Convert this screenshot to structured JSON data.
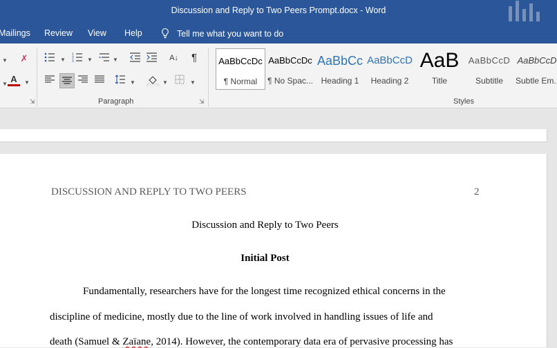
{
  "window": {
    "title": "Discussion and Reply to Two Peers Prompt.docx  -  Word"
  },
  "menu": {
    "tabs": [
      "Mailings",
      "Review",
      "View",
      "Help"
    ],
    "tell_me": "Tell me what you want to do"
  },
  "ribbon": {
    "paragraph_group_label": "Paragraph",
    "styles_group_label": "Styles",
    "styles": [
      {
        "preview": "AaBbCcDc",
        "label": "¶ Normal"
      },
      {
        "preview": "AaBbCcDc",
        "label": "¶ No Spac..."
      },
      {
        "preview": "AaBbCc",
        "label": "Heading 1"
      },
      {
        "preview": "AaBbCcD",
        "label": "Heading 2"
      },
      {
        "preview": "AaB",
        "label": "Title"
      },
      {
        "preview": "AaBbCcD",
        "label": "Subtitle"
      },
      {
        "preview": "AaBbCcD",
        "label": "Subtle Em..."
      }
    ],
    "font_color": "#c00000"
  },
  "document": {
    "running_head": "DISCUSSION AND REPLY TO TWO PEERS",
    "page_number": "2",
    "title": "Discussion and Reply to Two Peers",
    "section_heading": "Initial Post",
    "body_lines": [
      "Fundamentally, researchers have for the longest time recognized ethical concerns in the",
      "discipline of medicine, mostly due to the line of work involved in handling issues of life and"
    ],
    "line3": {
      "before": "death (Samuel & ",
      "flagged": "Zaïane",
      "after": ", 2014). However, the contemporary data era of pervasive processing has"
    }
  },
  "colors": {
    "titlebar": "#2b579a",
    "heading_preview": "#2e74b5"
  }
}
